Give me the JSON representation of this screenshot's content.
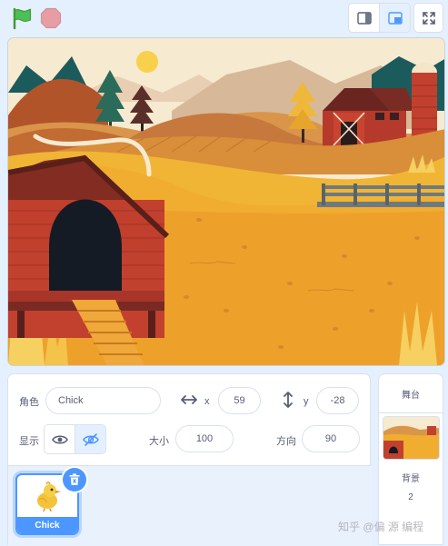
{
  "colors": {
    "accent": "#4c97ff",
    "flag": "#4cbf56",
    "stop": "#ec5959",
    "panel_bg": "#e5f0ff"
  },
  "toolbar": {
    "flag_icon": "green-flag-icon",
    "stop_icon": "stop-sign-icon",
    "small_stage_icon": "small-stage-icon",
    "normal_stage_icon": "normal-stage-icon",
    "fullscreen_icon": "fullscreen-icon"
  },
  "sprite_info": {
    "sprite_label": "角色",
    "sprite_name": "Chick",
    "x_label": "x",
    "x_value": "59",
    "y_label": "y",
    "y_value": "-28",
    "show_label": "显示",
    "size_label": "大小",
    "size_value": "100",
    "direction_label": "方向",
    "direction_value": "90"
  },
  "sprites": [
    {
      "name": "Chick",
      "selected": true
    }
  ],
  "stage_panel": {
    "title": "舞台",
    "backdrop_label": "背景",
    "backdrop_count": "2"
  },
  "watermark": "知乎 @偏 源 编程"
}
